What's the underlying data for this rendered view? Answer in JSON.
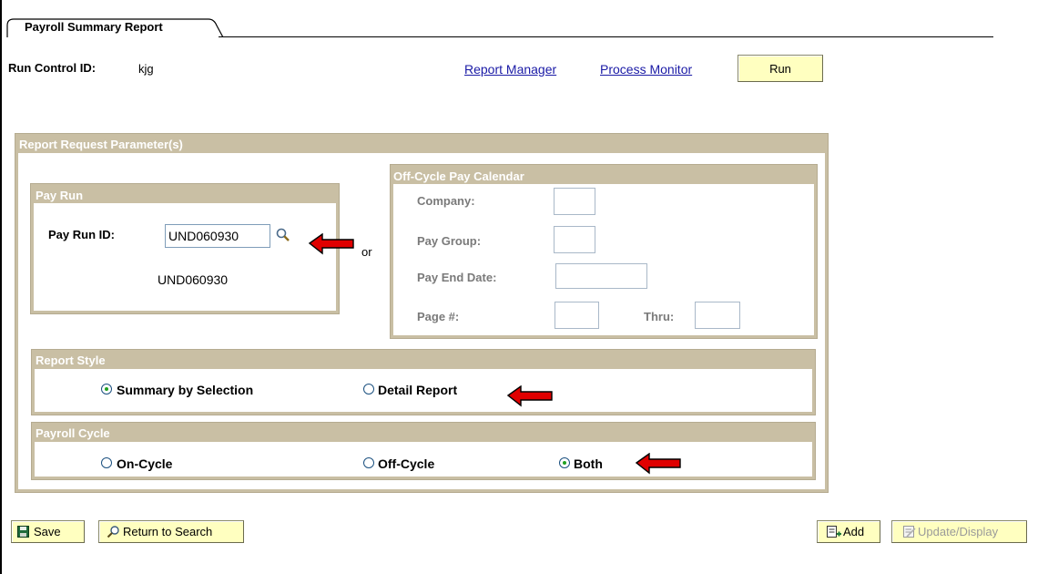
{
  "tab": {
    "label": "Payroll Summary Report"
  },
  "header": {
    "run_control_label": "Run Control ID:",
    "run_control_value": "kjg",
    "report_manager": "Report Manager",
    "process_monitor": "Process Monitor",
    "run_button": "Run"
  },
  "params": {
    "title": "Report Request Parameter(s)",
    "pay_run": {
      "title": "Pay Run",
      "id_label": "Pay Run ID:",
      "id_value": "UND060930",
      "id_description": "UND060930"
    },
    "or_text": "or",
    "off_cycle": {
      "title": "Off-Cycle Pay Calendar",
      "company_label": "Company:",
      "company_value": "",
      "pay_group_label": "Pay Group:",
      "pay_group_value": "",
      "pay_end_date_label": "Pay End Date:",
      "pay_end_date_value": "",
      "page_label": "Page #:",
      "page_value": "",
      "thru_label": "Thru:",
      "thru_value": ""
    },
    "report_style": {
      "title": "Report Style",
      "options": [
        {
          "label": "Summary by Selection",
          "selected": true
        },
        {
          "label": "Detail Report",
          "selected": false
        }
      ]
    },
    "payroll_cycle": {
      "title": "Payroll Cycle",
      "options": [
        {
          "label": "On-Cycle",
          "selected": false
        },
        {
          "label": "Off-Cycle",
          "selected": false
        },
        {
          "label": "Both",
          "selected": true
        }
      ]
    }
  },
  "footer": {
    "save": "Save",
    "return_to_search": "Return to Search",
    "add": "Add",
    "update_display": "Update/Display"
  },
  "colors": {
    "group_header": "#c9bfa4",
    "button_yellow": "#ffffc0",
    "link": "#1a1aa6",
    "annotation_arrow": "#e00000"
  }
}
